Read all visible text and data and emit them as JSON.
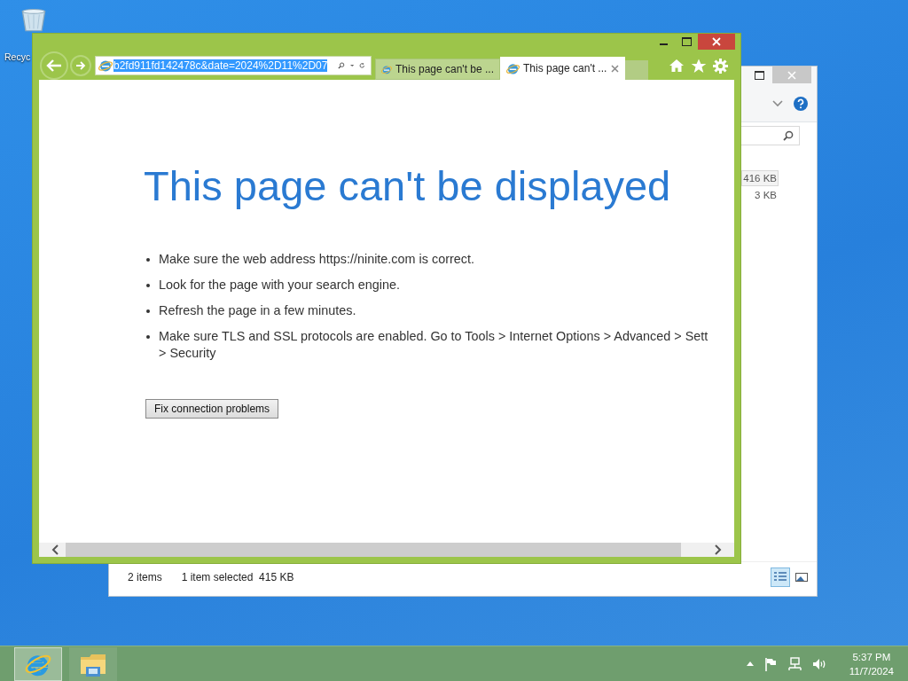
{
  "desktop": {
    "icons": [
      {
        "label": "Recyc"
      }
    ]
  },
  "explorer_window": {
    "rows": [
      {
        "size": "416 KB",
        "selected": true
      },
      {
        "size": "3 KB",
        "selected": false
      }
    ],
    "status_bar": {
      "item_count": "2 items",
      "selection": "1 item selected  415 KB"
    },
    "view_buttons": [
      {
        "kind": "details",
        "selected": true
      },
      {
        "kind": "thumbnails",
        "selected": false
      }
    ]
  },
  "browser_window": {
    "address": "b2fd911fd142478c&date=2024%2D11%2D07",
    "tabs": [
      {
        "title": "This page can't be ...",
        "selected": false
      },
      {
        "title": "This page can't ...",
        "selected": true
      }
    ],
    "page": {
      "heading": "This page can't be displayed",
      "bullets": [
        {
          "lines": [
            "Make sure the web address https://ninite.com is correct."
          ]
        },
        {
          "lines": [
            "Look for the page with your search engine."
          ]
        },
        {
          "lines": [
            "Refresh the page in a few minutes."
          ]
        },
        {
          "lines": [
            "Make sure TLS and SSL protocols are enabled. Go to Tools > Internet Options > Advanced > Sett",
            "> Security"
          ]
        }
      ],
      "button": "Fix connection problems"
    }
  },
  "taskbar": {
    "apps": [
      {
        "kind": "browser",
        "selected": true
      },
      {
        "kind": "files",
        "selected": false
      }
    ],
    "clock": {
      "time": "5:37 PM",
      "date": "11/7/2024"
    }
  }
}
